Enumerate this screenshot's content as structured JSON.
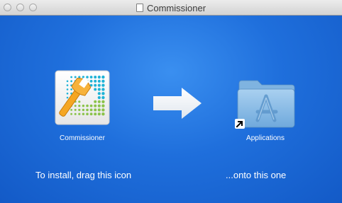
{
  "window": {
    "title": "Commissioner"
  },
  "app": {
    "name": "Commissioner"
  },
  "destination": {
    "name": "Applications"
  },
  "instructions": {
    "left": "To install, drag this icon",
    "right": "...onto this one"
  },
  "colors": {
    "background": "#1f6fdc",
    "text": "#ffffff",
    "wrench": "#f5a623",
    "dots_teal": "#1fb3d6",
    "dots_green": "#8bc34a",
    "folder": "#8fbde6"
  },
  "icons": {
    "app": "commissioner-app-icon",
    "arrow": "drag-arrow-icon",
    "folder": "applications-folder-icon",
    "alias": "alias-arrow-icon"
  }
}
